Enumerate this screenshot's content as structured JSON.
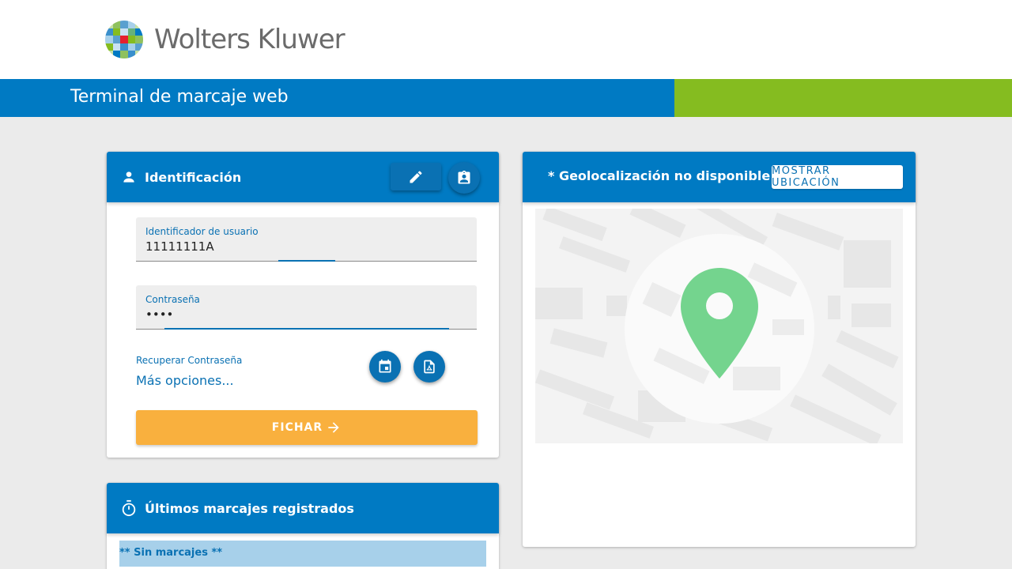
{
  "brand": {
    "name": "Wolters Kluwer",
    "colors": {
      "blue": "#007ac3",
      "green": "#85bc20",
      "orange": "#f9b03e",
      "light_blue": "#a7d0ea"
    }
  },
  "header": {
    "title": "Terminal de marcaje web"
  },
  "identification": {
    "title": "Identificación",
    "edit_icon": "pencil-icon",
    "badge_icon": "assignment-ind-icon",
    "user_field": {
      "label": "Identificador de usuario",
      "value": "11111111A"
    },
    "password_field": {
      "label": "Contraseña",
      "value": "••••"
    },
    "recover_link": "Recuperar Contraseña",
    "more_options": "Más opciones...",
    "calendar_icon": "calendar-event-icon",
    "pdf_icon": "pdf-file-icon",
    "submit_label": "FICHAR",
    "submit_icon": "arrow-right-icon"
  },
  "geolocation": {
    "title": "* Geolocalización no disponible *",
    "show_button": "MOSTRAR UBICACIÓN",
    "map_icon": "map-pin-icon"
  },
  "recent": {
    "title": "Últimos marcajes registrados",
    "icon": "stopwatch-icon",
    "empty_text": "** Sin marcajes **"
  }
}
